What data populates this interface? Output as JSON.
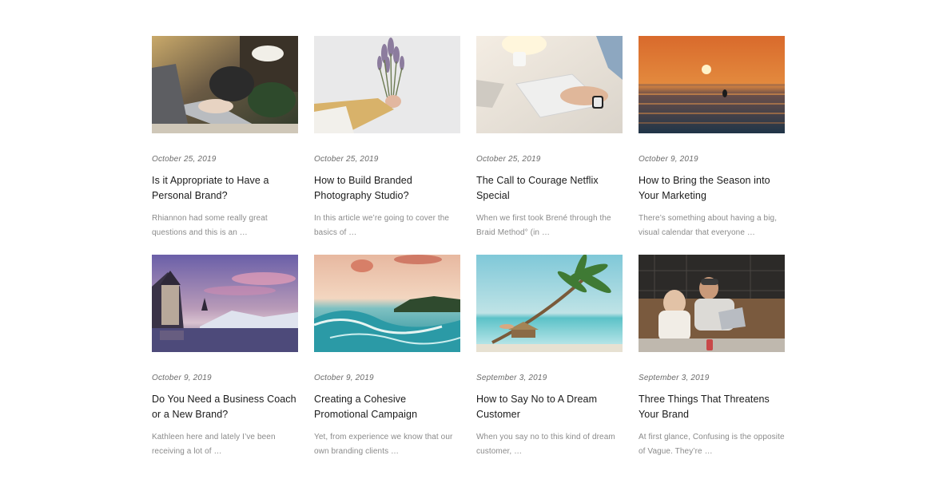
{
  "posts": [
    {
      "image": "laptop-typing-photo",
      "date": "October 25, 2019",
      "title": "Is it Appropriate to Have a Personal Brand?",
      "excerpt": "Rhiannon had some really great questions and this is an …"
    },
    {
      "image": "lavender-bouquet-photo",
      "date": "October 25, 2019",
      "title": "How to Build Branded Photography Studio?",
      "excerpt": "In this article we’re going to cover the basics of …"
    },
    {
      "image": "keyboard-desk-photo",
      "date": "October 25, 2019",
      "title": "The Call to Courage Netflix Special",
      "excerpt": "When we first took Brené through the Braid Method° (in …"
    },
    {
      "image": "ocean-sunset-photo",
      "date": "October 9, 2019",
      "title": "How to Bring the Season into Your Marketing",
      "excerpt": "There’s something about having a big, visual calendar that everyone …"
    },
    {
      "image": "lake-castle-photo",
      "date": "October 9, 2019",
      "title": "Do You Need a Business Coach or a New Brand?",
      "excerpt": "Kathleen here and lately I’ve been receiving a lot of …"
    },
    {
      "image": "ocean-wave-photo",
      "date": "October 9, 2019",
      "title": "Creating a Cohesive Promotional Campaign",
      "excerpt": "Yet, from experience we know that our own branding clients …"
    },
    {
      "image": "palm-beach-photo",
      "date": "September 3, 2019",
      "title": "How to Say No to A Dream Customer",
      "excerpt": "When you say no to this kind of dream customer, …"
    },
    {
      "image": "couple-laptop-photo",
      "date": "September 3, 2019",
      "title": "Three Things That Threatens Your Brand",
      "excerpt": "At first glance, Confusing is the opposite of Vague. They’re …"
    }
  ]
}
